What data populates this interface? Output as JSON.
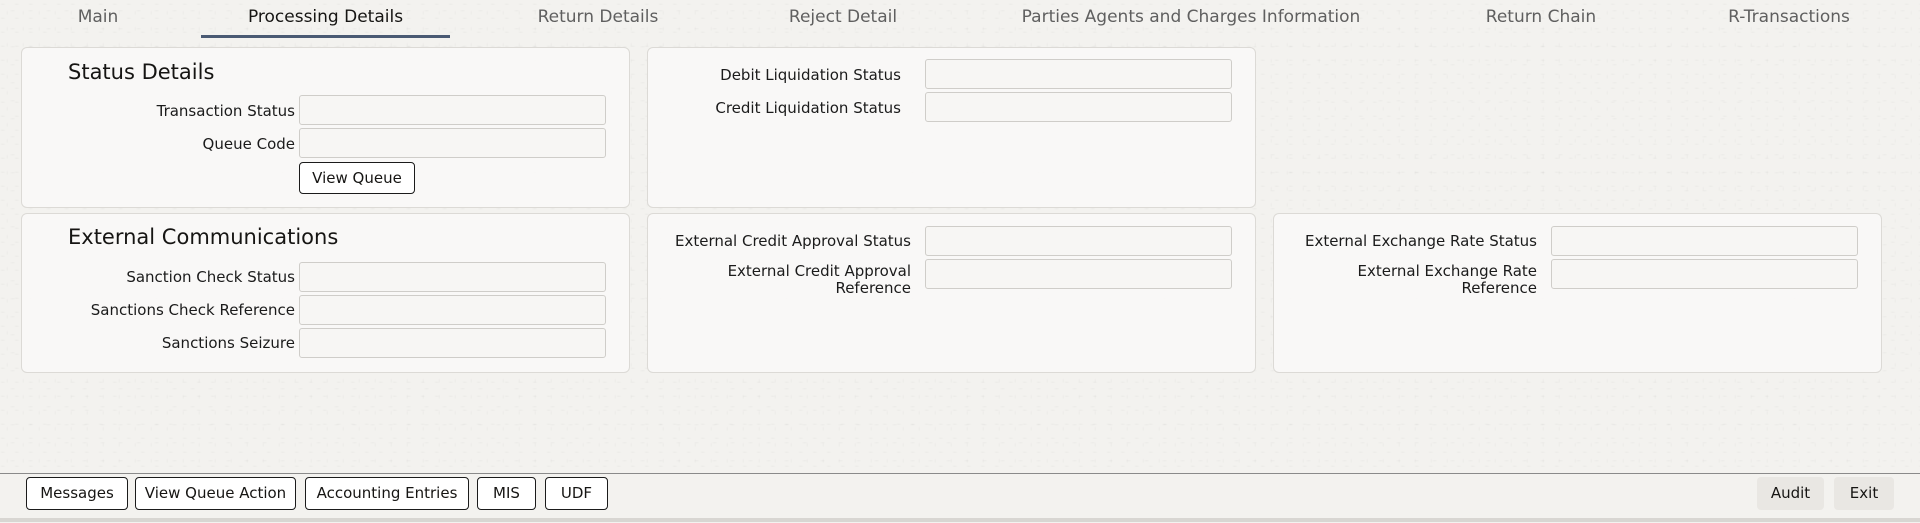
{
  "tabs": [
    {
      "label": "Main",
      "active": false
    },
    {
      "label": "Processing Details",
      "active": true
    },
    {
      "label": "Return Details",
      "active": false
    },
    {
      "label": "Reject Detail",
      "active": false
    },
    {
      "label": "Parties Agents and Charges Information",
      "active": false
    },
    {
      "label": "Return Chain",
      "active": false
    },
    {
      "label": "R-Transactions",
      "active": false
    }
  ],
  "status_details": {
    "title": "Status Details",
    "transaction_status": {
      "label": "Transaction Status",
      "value": ""
    },
    "queue_code": {
      "label": "Queue Code",
      "value": ""
    },
    "view_queue_button": "View Queue"
  },
  "liquidation": {
    "debit_liquidation_status": {
      "label": "Debit Liquidation Status",
      "value": ""
    },
    "credit_liquidation_status": {
      "label": "Credit Liquidation Status",
      "value": ""
    }
  },
  "external_communications": {
    "title": "External Communications",
    "sanction_check_status": {
      "label": "Sanction Check Status",
      "value": ""
    },
    "sanctions_check_reference": {
      "label": "Sanctions Check Reference",
      "value": ""
    },
    "sanctions_seizure": {
      "label": "Sanctions Seizure",
      "value": ""
    }
  },
  "external_credit": {
    "approval_status": {
      "label": "External Credit Approval Status",
      "value": ""
    },
    "approval_reference": {
      "label": "External Credit Approval Reference",
      "value": ""
    }
  },
  "external_exchange": {
    "rate_status": {
      "label": "External Exchange Rate Status",
      "value": ""
    },
    "rate_reference": {
      "label": "External Exchange Rate Reference",
      "value": ""
    }
  },
  "footer": {
    "messages": "Messages",
    "view_queue_action": "View Queue Action",
    "accounting_entries": "Accounting Entries",
    "mis": "MIS",
    "udf": "UDF",
    "audit": "Audit",
    "exit": "Exit"
  }
}
